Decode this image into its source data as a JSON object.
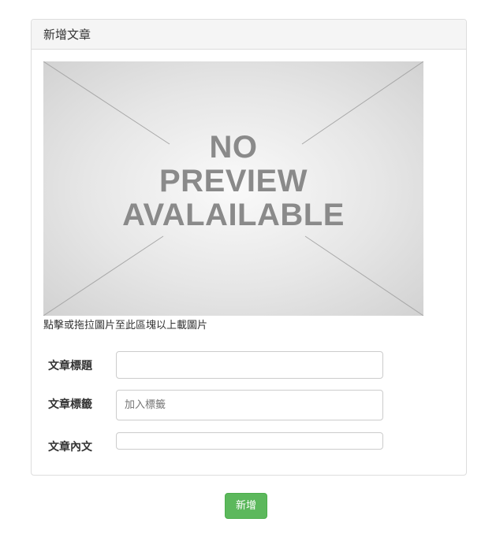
{
  "panel": {
    "title": "新增文章"
  },
  "preview": {
    "lines": [
      "NO",
      "PREVIEW",
      "AVALAILABLE"
    ],
    "hint": "點擊或拖拉圖片至此區塊以上載圖片"
  },
  "form": {
    "title_label": "文章標題",
    "title_value": "",
    "tags_label": "文章標籤",
    "tags_placeholder": "加入標籤",
    "content_label": "文章內文",
    "content_value": ""
  },
  "actions": {
    "add_label": "新增"
  },
  "colors": {
    "accent": "#5cb85c",
    "panel_heading_bg": "#f5f5f5",
    "border": "#dddddd"
  }
}
